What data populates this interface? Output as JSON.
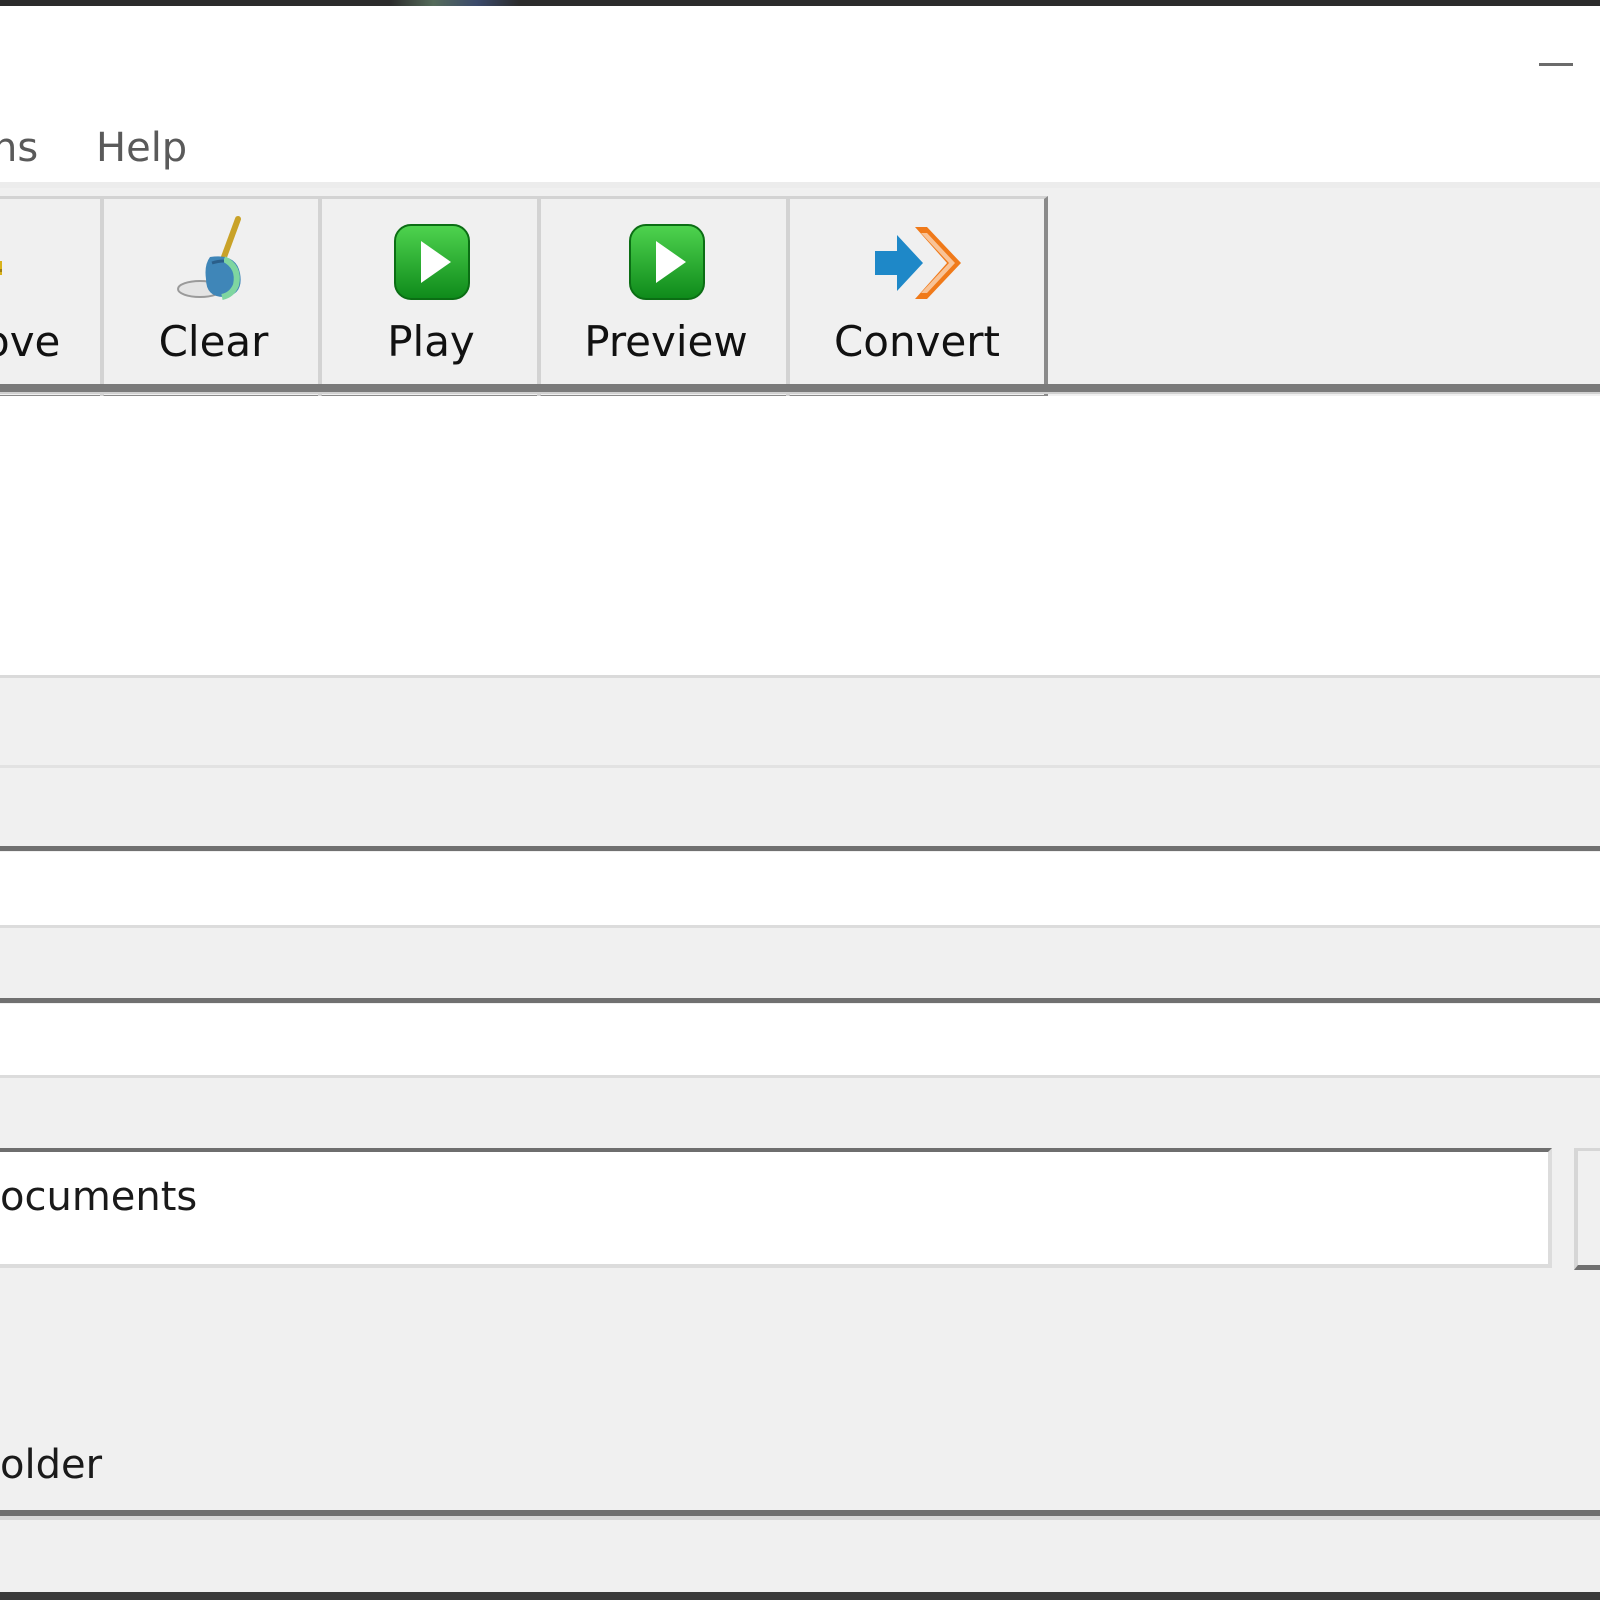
{
  "window": {
    "minimize_label": "—"
  },
  "menu": {
    "items": [
      "ns",
      "Help"
    ]
  },
  "toolbar": {
    "buttons": [
      {
        "label": "ove",
        "icon": "folder-remove-icon"
      },
      {
        "label": "Clear",
        "icon": "broom-icon"
      },
      {
        "label": "Play",
        "icon": "play-icon"
      },
      {
        "label": "Preview",
        "icon": "preview-play-icon"
      },
      {
        "label": "Convert",
        "icon": "convert-arrow-icon"
      }
    ]
  },
  "output": {
    "path_value": "ocuments",
    "folder_label": "older"
  },
  "colors": {
    "play_green": "#1fa01f",
    "convert_blue": "#1e88c8",
    "convert_orange": "#f07a1a"
  }
}
